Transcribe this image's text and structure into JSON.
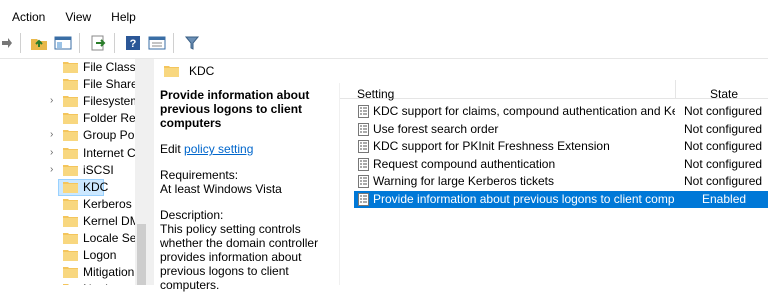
{
  "menu": [
    "Action",
    "View",
    "Help"
  ],
  "tree": {
    "items": [
      {
        "label": "File Classif",
        "expandable": false
      },
      {
        "label": "File Share",
        "expandable": false
      },
      {
        "label": "Filesystem",
        "expandable": true
      },
      {
        "label": "Folder Rec",
        "expandable": false
      },
      {
        "label": "Group Pol",
        "expandable": true
      },
      {
        "label": "Internet C",
        "expandable": true
      },
      {
        "label": "iSCSI",
        "expandable": true
      },
      {
        "label": "KDC",
        "expandable": false,
        "selected": true
      },
      {
        "label": "Kerberos",
        "expandable": false
      },
      {
        "label": "Kernel DM",
        "expandable": false
      },
      {
        "label": "Locale Ser",
        "expandable": false
      },
      {
        "label": "Logon",
        "expandable": false
      },
      {
        "label": "Mitigation",
        "expandable": false
      },
      {
        "label": "Net Logon",
        "expandable": true
      }
    ]
  },
  "header": {
    "title": "KDC"
  },
  "description": {
    "heading": "Provide information about previous logons to client computers",
    "edit_prefix": "Edit ",
    "edit_link": "policy setting",
    "requirements_label": "Requirements:",
    "requirements_value": "At least Windows Vista",
    "description_label": "Description:",
    "description_text": "This policy setting controls whether the domain controller provides information about previous logons to client computers."
  },
  "table": {
    "col_setting": "Setting",
    "col_state": "State",
    "rows": [
      {
        "name": "KDC support for claims, compound authentication and Kerb...",
        "state": "Not configured"
      },
      {
        "name": "Use forest search order",
        "state": "Not configured"
      },
      {
        "name": "KDC support for PKInit Freshness Extension",
        "state": "Not configured"
      },
      {
        "name": "Request compound authentication",
        "state": "Not configured"
      },
      {
        "name": "Warning for large Kerberos tickets",
        "state": "Not configured"
      },
      {
        "name": "Provide information about previous logons to client compu...",
        "state": "Enabled",
        "selected": true
      }
    ]
  },
  "colors": {
    "selection": "#0078d7",
    "tree_selection": "#cce8ff",
    "link": "#0066cc",
    "folder": "#f4c55c"
  }
}
